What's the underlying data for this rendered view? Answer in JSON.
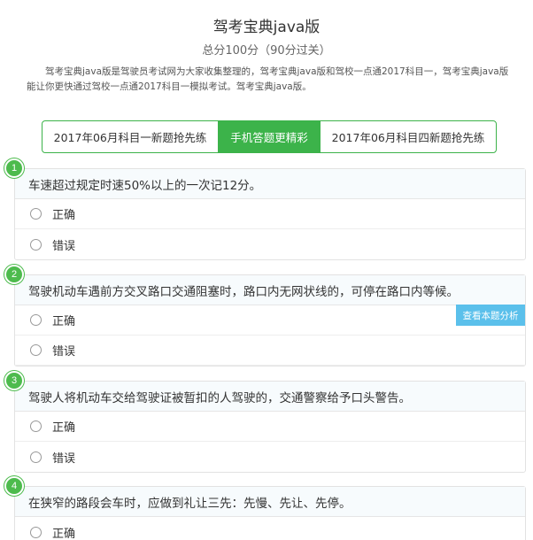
{
  "header": {
    "title": "驾考宝典java版",
    "subtitle": "总分100分（90分过关）",
    "intro": "驾考宝典java版是驾驶员考试网为大家收集整理的，驾考宝典java版和驾校一点通2017科目一，驾考宝典java版能让你更快通过驾校一点通2017科目一模拟考试。驾考宝典java版。"
  },
  "tabs": [
    {
      "label": "2017年06月科目一新题抢先练",
      "active": false
    },
    {
      "label": "手机答题更精彩",
      "active": true
    },
    {
      "label": "2017年06月科目四新题抢先练",
      "active": false
    }
  ],
  "theme": {
    "accent": "#3cb34a",
    "badge": "#4dbb4d",
    "analysis": "#5bc0eb"
  },
  "questions": [
    {
      "num": "1",
      "text": "车速超过规定时速50%以上的一次记12分。",
      "options": [
        "正确",
        "错误"
      ]
    },
    {
      "num": "2",
      "text": "驾驶机动车遇前方交叉路口交通阻塞时，路口内无网状线的，可停在路口内等候。",
      "options": [
        "正确",
        "错误"
      ],
      "analysis_label": "查看本题分析"
    },
    {
      "num": "3",
      "text": "驾驶人将机动车交给驾驶证被暂扣的人驾驶的，交通警察给予口头警告。",
      "options": [
        "正确",
        "错误"
      ]
    },
    {
      "num": "4",
      "text": "在狭窄的路段会车时，应做到礼让三先：先慢、先让、先停。",
      "options": [
        "正确"
      ]
    }
  ]
}
